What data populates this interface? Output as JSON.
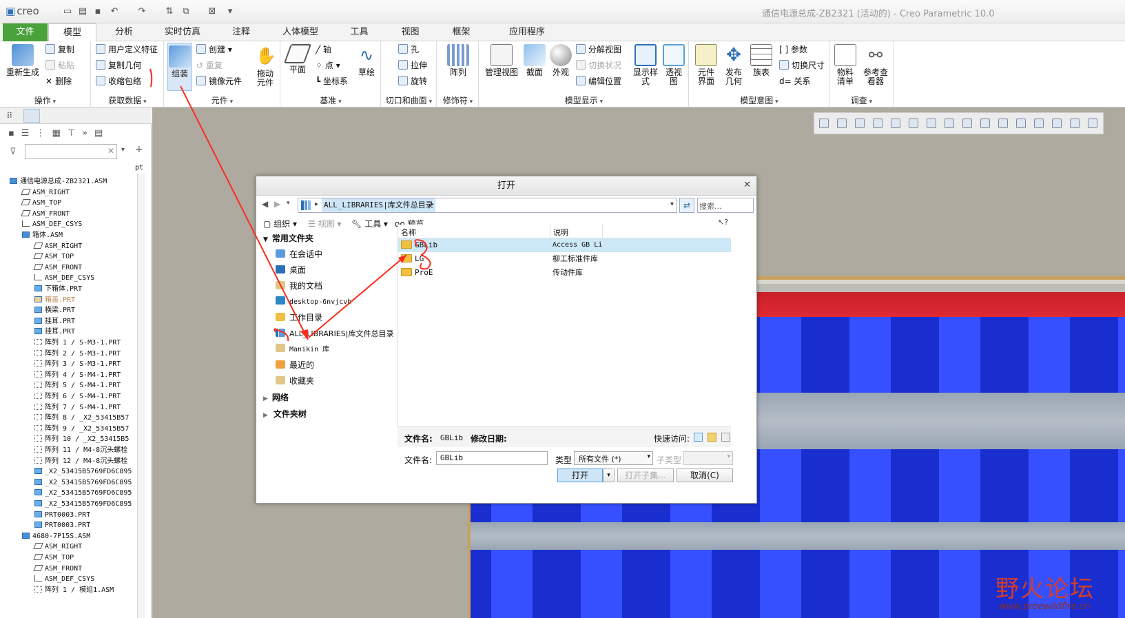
{
  "app": {
    "logo": "creo",
    "window_title": "通信电源总成-ZB2321 (活动的) - Creo Parametric 10.0"
  },
  "tabs": [
    "文件",
    "模型",
    "分析",
    "实时仿真",
    "注释",
    "人体模型",
    "工具",
    "视图",
    "框架",
    "应用程序"
  ],
  "active_tab": "模型",
  "ribbon": {
    "operations": {
      "regen": "重新生成",
      "copy": "复制",
      "paste": "粘贴",
      "delete": "删除",
      "label": "操作"
    },
    "get_data": {
      "udf": "用户定义特征",
      "copy_geom": "复制几何",
      "shrinkwrap": "收缩包络",
      "label": "获取数据"
    },
    "component": {
      "assemble": "组装",
      "create": "创建",
      "repeat": "重复",
      "mirror": "镜像元件",
      "drag": "拖动元件",
      "label": "元件"
    },
    "datum": {
      "plane": "平面",
      "axis": "轴",
      "point": "点",
      "csys": "坐标系",
      "sketch": "草绘",
      "label": "基准"
    },
    "cut_surface": {
      "hole": "孔",
      "extrude": "拉伸",
      "revolve": "旋转",
      "label": "切口和曲面"
    },
    "modifiers": {
      "pattern": "阵列",
      "label": "修饰符"
    },
    "model_display": {
      "manage_views": "管理视图",
      "section": "截面",
      "appearance": "外观",
      "explode": "分解视图",
      "toggle_status": "切换状况",
      "edit_position": "编辑位置",
      "display_style": "显示样式",
      "perspective": "透视图",
      "label": "模型显示"
    },
    "model_intent": {
      "comp_interface": "元件界面",
      "publish_geom": "发布几何",
      "family_table": "族表",
      "params": "参数",
      "switch_dims": "切换尺寸",
      "relations": "关系",
      "label": "模型意图"
    },
    "investigate": {
      "bom": "物料清单",
      "ref_viewer": "参考查看器",
      "label": "调查"
    }
  },
  "tree": {
    "col_header": "pt",
    "items": [
      {
        "text": "通信电源总成-ZB2321.ASM",
        "indent": 0,
        "kind": "asm"
      },
      {
        "text": "ASM_RIGHT",
        "indent": 1,
        "kind": "plane"
      },
      {
        "text": "ASM_TOP",
        "indent": 1,
        "kind": "plane"
      },
      {
        "text": "ASM_FRONT",
        "indent": 1,
        "kind": "plane"
      },
      {
        "text": "ASM_DEF_CSYS",
        "indent": 1,
        "kind": "csys"
      },
      {
        "text": "箱体.ASM",
        "indent": 1,
        "kind": "asm"
      },
      {
        "text": "ASM_RIGHT",
        "indent": 2,
        "kind": "plane"
      },
      {
        "text": "ASM_TOP",
        "indent": 2,
        "kind": "plane"
      },
      {
        "text": "ASM_FRONT",
        "indent": 2,
        "kind": "plane"
      },
      {
        "text": "ASM_DEF_CSYS",
        "indent": 2,
        "kind": "csys"
      },
      {
        "text": "下箱体.PRT",
        "indent": 2,
        "kind": "part"
      },
      {
        "text": "箱盖.PRT",
        "indent": 2,
        "kind": "part-dim"
      },
      {
        "text": "横梁.PRT",
        "indent": 2,
        "kind": "part"
      },
      {
        "text": "挂耳.PRT",
        "indent": 2,
        "kind": "part"
      },
      {
        "text": "挂耳.PRT",
        "indent": 2,
        "kind": "part"
      },
      {
        "text": "阵列 1 / S-M3-1.PRT",
        "indent": 2,
        "kind": "pattern"
      },
      {
        "text": "阵列 2 / S-M3-1.PRT",
        "indent": 2,
        "kind": "pattern"
      },
      {
        "text": "阵列 3 / S-M3-1.PRT",
        "indent": 2,
        "kind": "pattern"
      },
      {
        "text": "阵列 4 / S-M4-1.PRT",
        "indent": 2,
        "kind": "pattern"
      },
      {
        "text": "阵列 5 / S-M4-1.PRT",
        "indent": 2,
        "kind": "pattern"
      },
      {
        "text": "阵列 6 / S-M4-1.PRT",
        "indent": 2,
        "kind": "pattern"
      },
      {
        "text": "阵列 7 / S-M4-1.PRT",
        "indent": 2,
        "kind": "pattern"
      },
      {
        "text": "阵列 8 / _X2_53415B57",
        "indent": 2,
        "kind": "pattern"
      },
      {
        "text": "阵列 9 / _X2_53415B57",
        "indent": 2,
        "kind": "pattern"
      },
      {
        "text": "阵列 10 / _X2_53415B5",
        "indent": 2,
        "kind": "pattern"
      },
      {
        "text": "阵列 11 / M4-8沉头螺栓",
        "indent": 2,
        "kind": "pattern"
      },
      {
        "text": "阵列 12 / M4-8沉头螺栓",
        "indent": 2,
        "kind": "pattern"
      },
      {
        "text": "_X2_53415B5769FD6C895",
        "indent": 2,
        "kind": "part"
      },
      {
        "text": "_X2_53415B5769FD6C895",
        "indent": 2,
        "kind": "part"
      },
      {
        "text": "_X2_53415B5769FD6C895",
        "indent": 2,
        "kind": "part"
      },
      {
        "text": "_X2_53415B5769FD6C895",
        "indent": 2,
        "kind": "part"
      },
      {
        "text": "PRT0003.PRT",
        "indent": 2,
        "kind": "part"
      },
      {
        "text": "PRT0003.PRT",
        "indent": 2,
        "kind": "part"
      },
      {
        "text": "4680-7P15S.ASM",
        "indent": 1,
        "kind": "asm"
      },
      {
        "text": "ASM_RIGHT",
        "indent": 2,
        "kind": "plane"
      },
      {
        "text": "ASM_TOP",
        "indent": 2,
        "kind": "plane"
      },
      {
        "text": "ASM_FRONT",
        "indent": 2,
        "kind": "plane"
      },
      {
        "text": "ASM_DEF_CSYS",
        "indent": 2,
        "kind": "csys"
      },
      {
        "text": "阵列 1 / 模组1.ASM",
        "indent": 2,
        "kind": "pattern"
      }
    ]
  },
  "dialog": {
    "title": "打开",
    "path": "ALL_LIBRARIES|库文件总目录",
    "search_placeholder": "搜索...",
    "toolbar": {
      "organize": "组织",
      "views": "视图",
      "tools": "工具",
      "preview": "预览"
    },
    "nav": {
      "common_header": "常用文件夹",
      "network": "网络",
      "folder_tree": "文件夹树",
      "items": [
        "在会话中",
        "桌面",
        "我的文档",
        "desktop-6nvjcvb",
        "工作目录",
        "ALL_LIBRARIES|库文件总目录",
        "Manikin 库",
        "最近的",
        "收藏夹"
      ]
    },
    "columns": {
      "name": "名称",
      "desc": "说明"
    },
    "files": [
      {
        "name": "GBLib",
        "desc": "Access GB Li"
      },
      {
        "name": "LG",
        "desc": "柳工标准件库"
      },
      {
        "name": "ProE",
        "desc": "传动件库"
      }
    ],
    "info": {
      "filename_label": "文件名:",
      "filename_value": "GBLib",
      "modified_label": "修改日期:",
      "quick_access": "快速访问:"
    },
    "bottom": {
      "filename_label": "文件名:",
      "filename_value": "GBLib",
      "type_label": "类型",
      "type_value": "所有文件 (*)",
      "subtype_label": "子类型",
      "open": "打开",
      "open_subset": "打开子集...",
      "cancel": "取消(C)"
    }
  },
  "watermark": {
    "title": "野火论坛",
    "url": "www.proewildfire.cn"
  },
  "colors": {
    "file_tab": "#4aa23b",
    "selection": "#cde8f7",
    "annotation": "#ff2a1a"
  }
}
